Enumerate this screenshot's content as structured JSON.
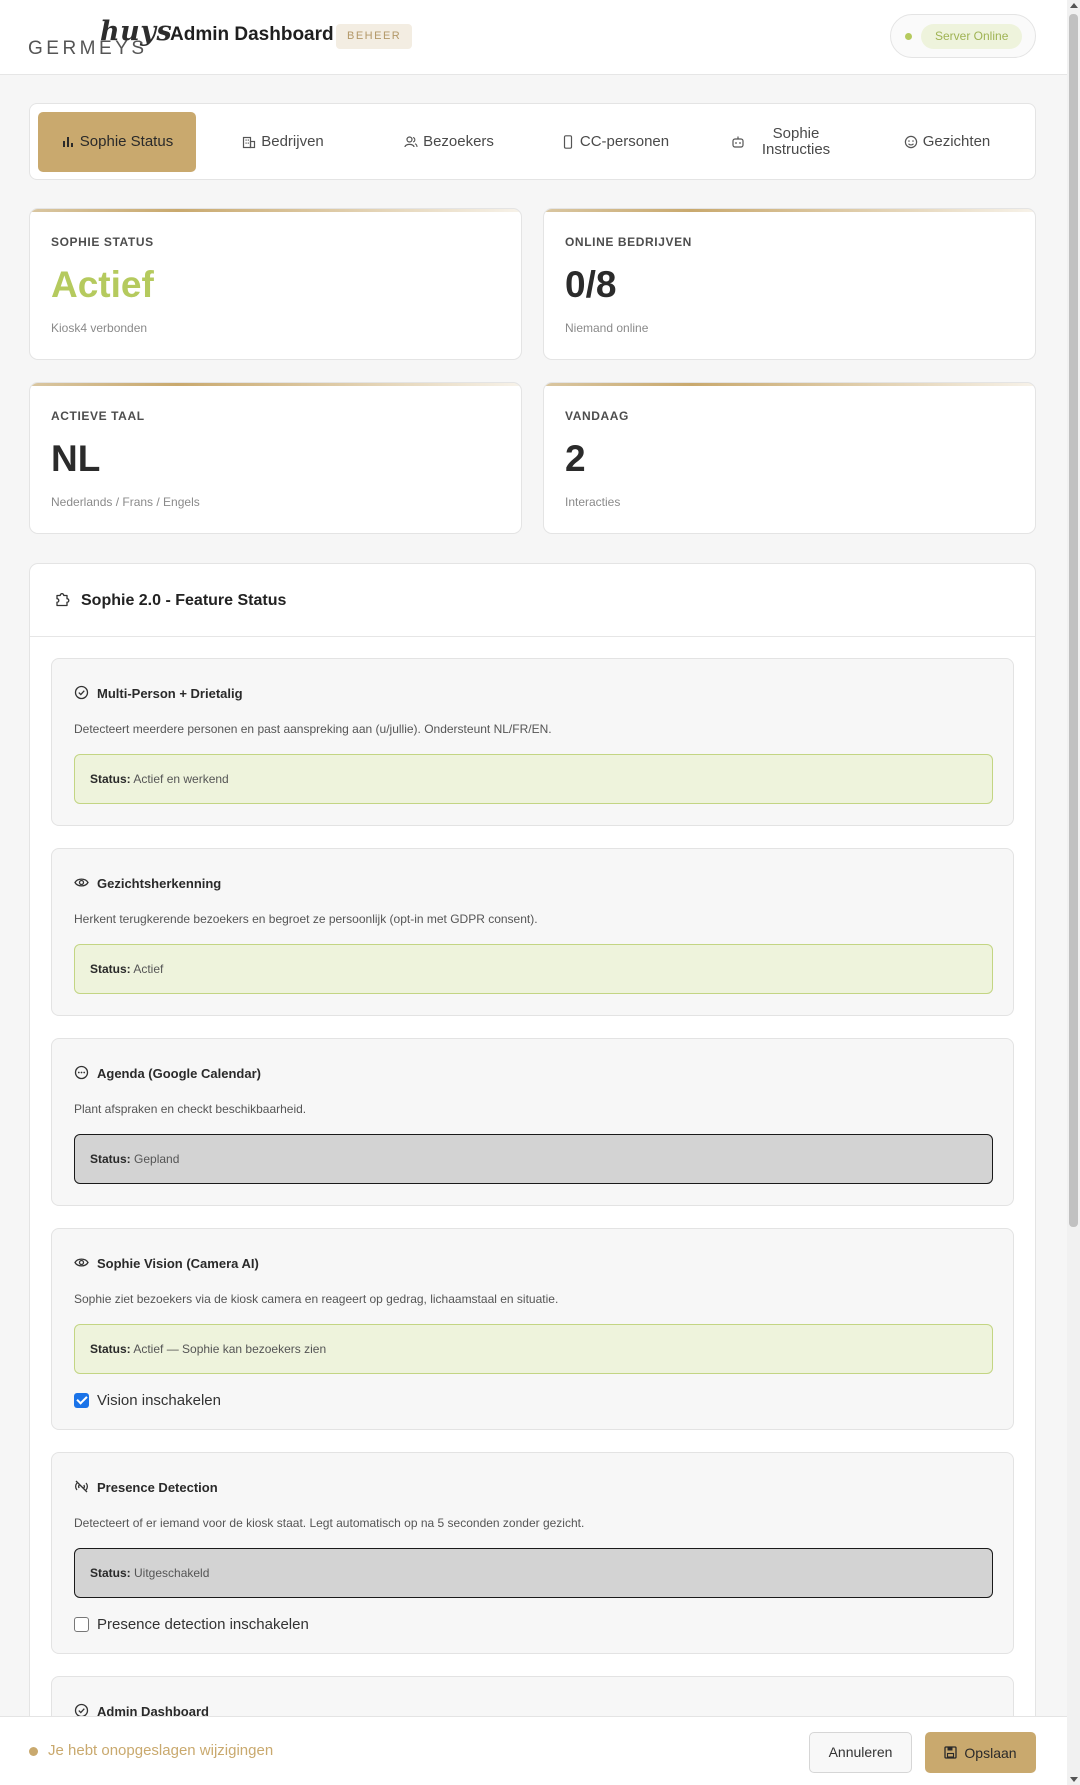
{
  "header": {
    "logo_top": "huys",
    "logo_bottom": "GERMEYS",
    "title": "Admin Dashboard",
    "badge": "BEHEER",
    "server_status": "Server Online"
  },
  "tabs": [
    {
      "label": "Sophie Status",
      "icon": "bar-chart-icon",
      "active": true
    },
    {
      "label": "Bedrijven",
      "icon": "building-icon"
    },
    {
      "label": "Bezoekers",
      "icon": "users-icon"
    },
    {
      "label": "CC-personen",
      "icon": "phone-icon"
    },
    {
      "label": "Sophie Instructies",
      "icon": "robot-icon"
    },
    {
      "label": "Gezichten",
      "icon": "face-icon"
    }
  ],
  "stats": [
    {
      "label": "SOPHIE STATUS",
      "value": "Actief",
      "sub": "Kiosk4 verbonden"
    },
    {
      "label": "ONLINE BEDRIJVEN",
      "value": "0/8",
      "sub": "Niemand online"
    },
    {
      "label": "ACTIEVE TAAL",
      "value": "NL",
      "sub": "Nederlands / Frans / Engels"
    },
    {
      "label": "VANDAAG",
      "value": "2",
      "sub": "Interacties"
    }
  ],
  "feature_panel": {
    "title": "Sophie 2.0 - Feature Status",
    "status_prefix": "Status:",
    "features": [
      {
        "title": "Multi-Person + Drietalig",
        "icon": "check-circle-icon",
        "desc": "Detecteert meerdere personen en past aanspreking aan (u/jullie). Ondersteunt NL/FR/EN.",
        "status": "Actief en werkend"
      },
      {
        "title": "Gezichtsherkenning",
        "icon": "eye-icon",
        "desc": "Herkent terugkerende bezoekers en begroet ze persoonlijk (opt-in met GDPR consent).",
        "status": "Actief"
      },
      {
        "title": "Agenda (Google Calendar)",
        "icon": "ellipsis-circle-icon",
        "desc": "Plant afspraken en checkt beschikbaarheid.",
        "status": "Gepland"
      },
      {
        "title": "Sophie Vision (Camera AI)",
        "icon": "eye-icon",
        "desc": "Sophie ziet bezoekers via de kiosk camera en reageert op gedrag, lichaamstaal en situatie.",
        "status": "Actief — Sophie kan bezoekers zien",
        "checkbox": "Vision inschakelen"
      },
      {
        "title": "Presence Detection",
        "icon": "signal-off-icon",
        "desc": "Detecteert of er iemand voor de kiosk staat. Legt automatisch op na 5 seconden zonder gezicht.",
        "status": "Uitgeschakeld",
        "checkbox": "Presence detection inschakelen"
      },
      {
        "title": "Admin Dashboard",
        "icon": "check-circle-icon"
      }
    ]
  },
  "bottom_bar": {
    "message": "Je hebt onopgeslagen wijzigingen",
    "cancel": "Annuleren",
    "save": "Opslaan"
  },
  "colors": {
    "accent": "#c9a96e",
    "active_green": "#b5ca5e",
    "status_on_bg": "#eef3dc",
    "status_off_bg": "#d3d3d3",
    "checkbox_blue": "#1a73e8"
  }
}
